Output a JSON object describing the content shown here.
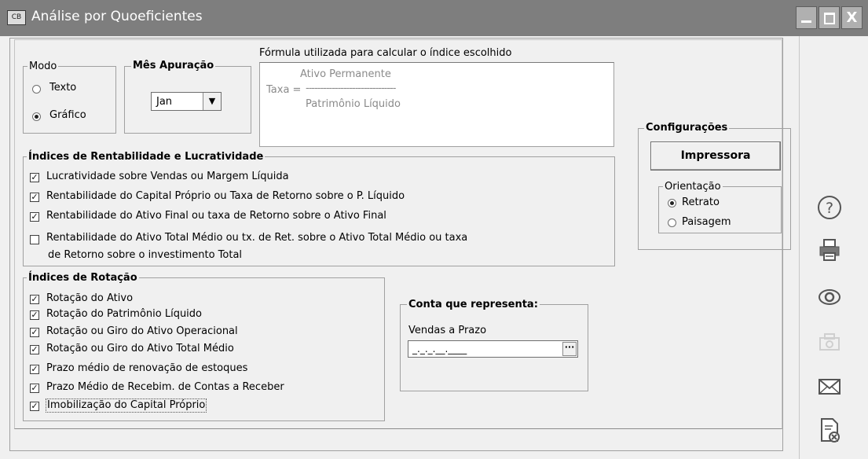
{
  "window": {
    "app_icon": "CB",
    "title": "Análise por Quoeficientes",
    "close_glyph": "X"
  },
  "modo": {
    "legend": "Modo",
    "options": [
      "Texto",
      "Gráfico"
    ],
    "selected": "Gráfico"
  },
  "mes": {
    "legend": "Mês Apuração",
    "value": "Jan",
    "arrow": "▼"
  },
  "formula": {
    "legend": "Fórmula utilizada para calcular o índice escolhido",
    "label": "Taxa =",
    "numerator": "Ativo Permanente",
    "line": "-------------------------------",
    "denominator": "Patrimônio Líquido"
  },
  "rentabilidade": {
    "legend": "Índices de Rentabilidade e Lucratividade",
    "items": [
      {
        "label": "Lucratividade sobre Vendas ou Margem Líquida",
        "checked": true
      },
      {
        "label": "Rentabilidade do Capital Próprio ou Taxa de Retorno sobre o P.  Líquido",
        "checked": true
      },
      {
        "label": "Rentabilidade do Ativo Final ou taxa de Retorno sobre o Ativo Final",
        "checked": true
      },
      {
        "label": "Rentabilidade do Ativo Total Médio ou tx. de Ret. sobre o Ativo Total Médio ou taxa",
        "label2": "de Retorno sobre o investimento Total",
        "checked": false
      }
    ]
  },
  "rotacao": {
    "legend": "Índices de Rotação",
    "items": [
      {
        "label": "Rotação do Ativo",
        "checked": true
      },
      {
        "label": "Rotação do Patrimônio Líquido",
        "checked": true
      },
      {
        "label": "Rotação ou Giro do Ativo Operacional",
        "checked": true
      },
      {
        "label": "Rotação ou Giro do Ativo Total Médio",
        "checked": true
      },
      {
        "label": "Prazo médio de renovação de estoques",
        "checked": true
      },
      {
        "label": "Prazo Médio de Recebim. de Contas a Receber",
        "checked": true
      },
      {
        "label": "Imobilização do Capital Próprio",
        "checked": true
      }
    ]
  },
  "conta": {
    "legend": "Conta que representa:",
    "label": "Vendas a Prazo",
    "value": "_._._.__.____",
    "button": "···"
  },
  "config": {
    "legend": "Configurações",
    "button": "Impressora",
    "orientacao": {
      "legend": "Orientação",
      "options": [
        "Retrato",
        "Paisagem"
      ],
      "selected": "Retrato"
    }
  },
  "toolbar_icons": [
    "help-icon",
    "printer-icon",
    "preview-eye-icon",
    "disabled-export-icon",
    "email-icon",
    "close-document-icon"
  ],
  "colors": {
    "titlebar": "#7e7e7e",
    "background": "#f0f0f0"
  }
}
